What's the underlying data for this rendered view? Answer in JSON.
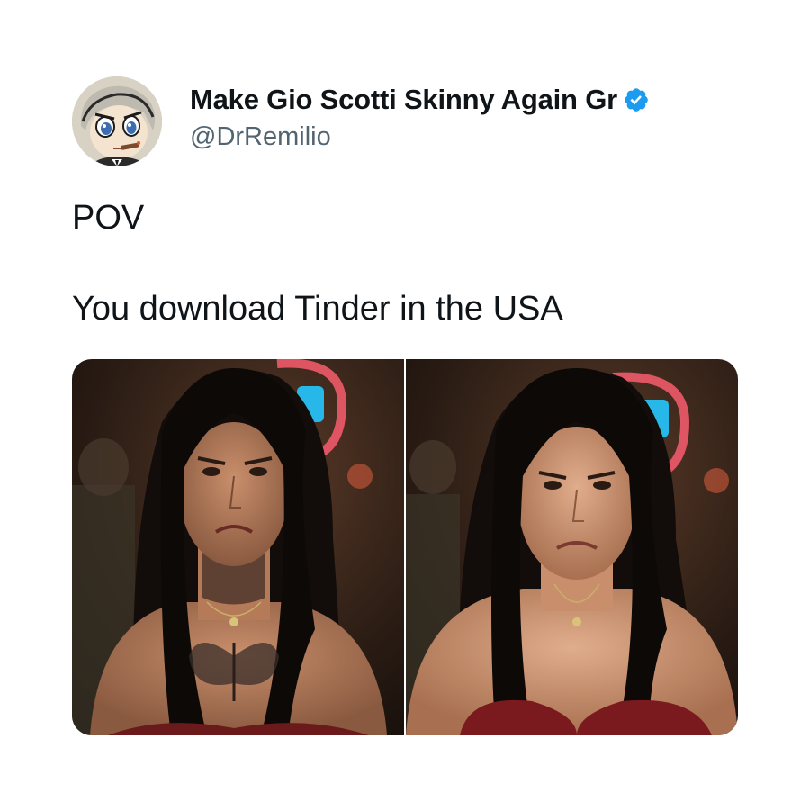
{
  "tweet": {
    "author": {
      "display_name": "Make Gio Scotti Skinny Again Gr",
      "handle": "@DrRemilio",
      "verified": true,
      "verified_icon": "verified-badge-icon",
      "avatar_icon": "cartoon-avatar-icon"
    },
    "text_lines": [
      "POV",
      "You download Tinder in the USA"
    ],
    "media": [
      {
        "description_icon": "photo-woman-frowning-with-tattoos"
      },
      {
        "description_icon": "photo-woman-frowning-no-tattoos"
      }
    ]
  },
  "colors": {
    "text": "#0f1419",
    "handle": "#536471",
    "verified": "#1d9bf0",
    "background": "#ffffff"
  }
}
